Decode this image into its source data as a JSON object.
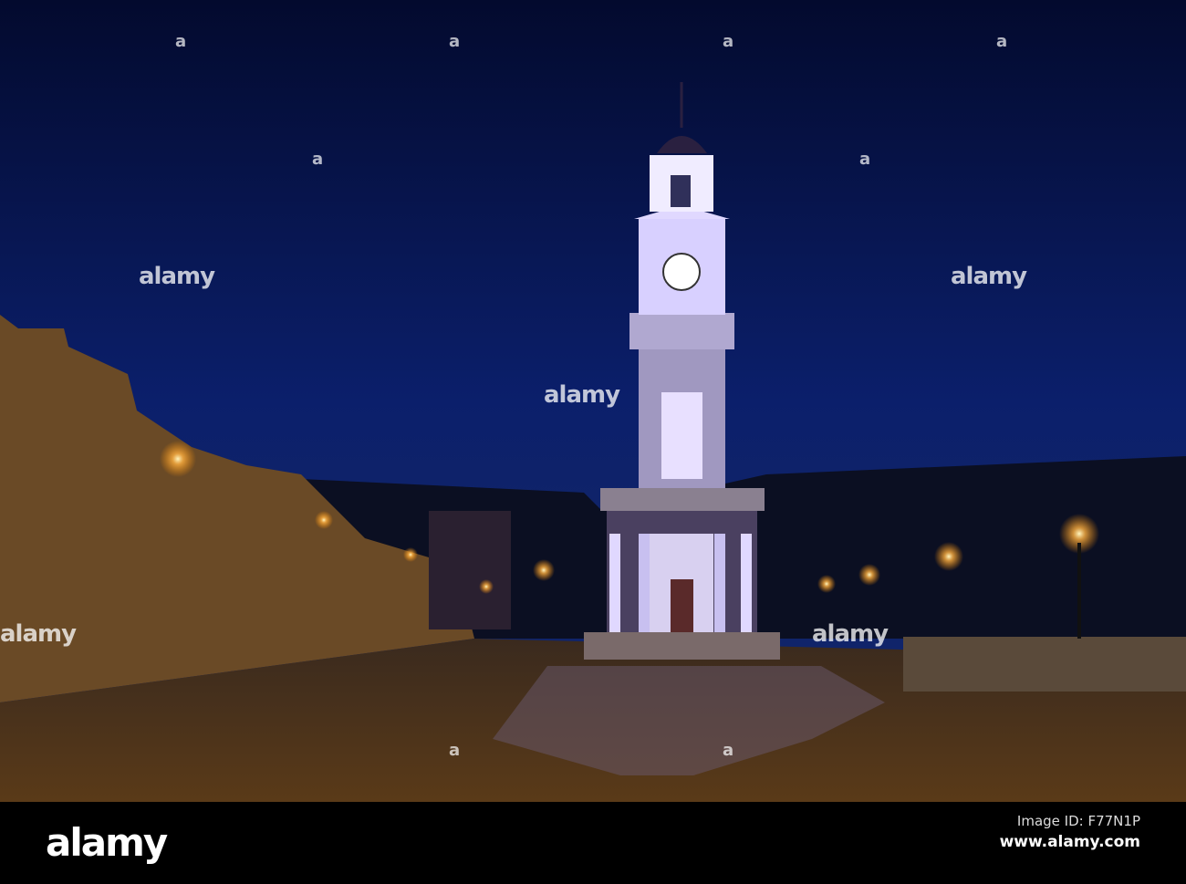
{
  "watermark": {
    "brand": "alamy",
    "letter": "a"
  },
  "footer": {
    "logo": "alamy",
    "image_id": "Image ID: F77N1P",
    "website": "www.alamy.com"
  }
}
